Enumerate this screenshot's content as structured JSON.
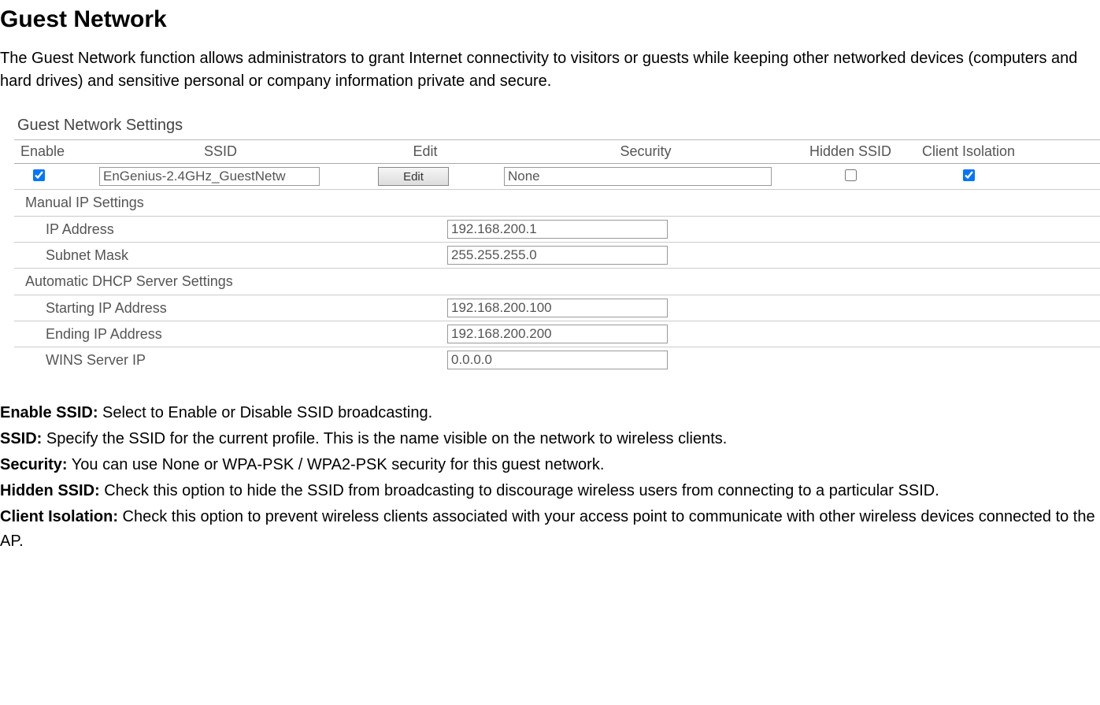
{
  "page": {
    "title": "Guest Network",
    "intro": "The Guest Network function allows administrators to grant Internet connectivity to visitors or guests while keeping other networked devices (computers and hard drives) and sensitive personal or company information private and secure."
  },
  "panel": {
    "title": "Guest Network Settings",
    "headers": {
      "enable": "Enable",
      "ssid": "SSID",
      "edit": "Edit",
      "security": "Security",
      "hidden": "Hidden SSID",
      "isolation": "Client Isolation"
    },
    "row": {
      "enable_checked": true,
      "ssid_value": "EnGenius-2.4GHz_GuestNetw",
      "edit_label": "Edit",
      "security_value": "None",
      "hidden_checked": false,
      "isolation_checked": true
    },
    "manual_ip": {
      "section_title": "Manual IP Settings",
      "ip_address_label": "IP Address",
      "ip_address_value": "192.168.200.1",
      "subnet_label": "Subnet Mask",
      "subnet_value": "255.255.255.0"
    },
    "dhcp": {
      "section_title": "Automatic DHCP Server Settings",
      "start_label": "Starting IP Address",
      "start_value": "192.168.200.100",
      "end_label": "Ending IP Address",
      "end_value": "192.168.200.200",
      "wins_label": "WINS Server IP",
      "wins_value": "0.0.0.0"
    }
  },
  "desc": {
    "enable_ssid_label": "Enable SSID:",
    "enable_ssid_text": " Select to Enable or Disable SSID broadcasting.",
    "ssid_label": "SSID:",
    "ssid_text": " Specify the SSID for the current profile. This is the name visible on the network to wireless clients.",
    "security_label": "Security:",
    "security_text": " You can use None or WPA-PSK / WPA2-PSK security for this guest network.",
    "hidden_label": "Hidden SSID:",
    "hidden_text": " Check this option to hide the SSID from broadcasting to discourage wireless users from connecting to a particular SSID.",
    "isolation_label": "Client Isolation:",
    "isolation_text": " Check this option to prevent wireless clients associated with your access point to communicate with other wireless devices connected to the AP."
  }
}
